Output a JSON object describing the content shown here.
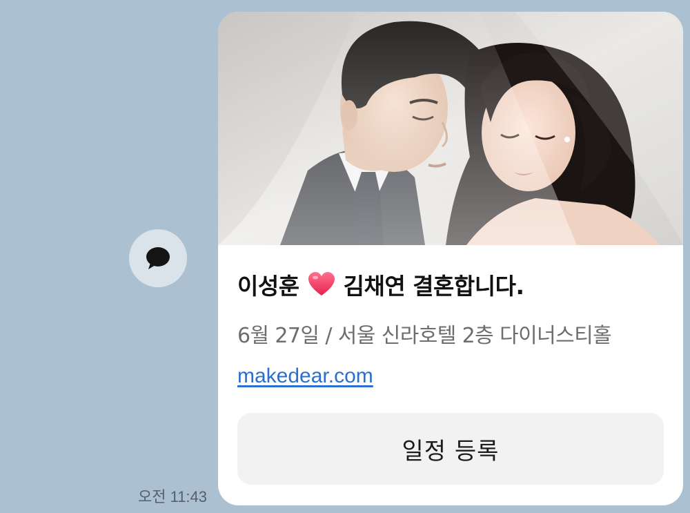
{
  "message": {
    "sender_avatar_icon": "chat-bubble-icon",
    "timestamp": "오전 11:43",
    "card": {
      "photo_alt": "wedding photo",
      "title_left": "이성훈",
      "title_icon": "heart-icon",
      "title_right": "김채연 결혼합니다.",
      "subtitle": "6월 27일 / 서울 신라호텔 2층 다이너스티홀",
      "link": "makedear.com",
      "button_label": "일정 등록"
    }
  },
  "colors": {
    "chat_background": "#abc1d1",
    "card_background": "#ffffff",
    "link": "#2a6fcf",
    "heart": "#f03a63",
    "button_background": "#f2f2f2"
  }
}
